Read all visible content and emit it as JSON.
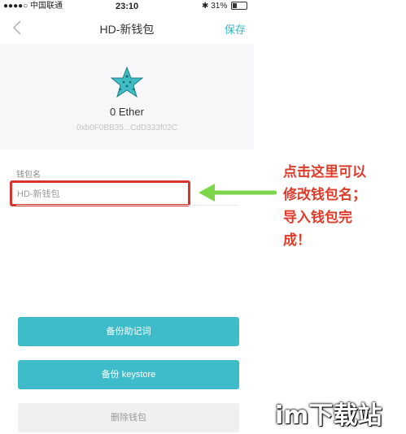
{
  "status_bar": {
    "carrier": "●●●●○ 中国联通",
    "time": "23:10",
    "battery": "31%"
  },
  "nav": {
    "title": "HD-新钱包",
    "save_label": "保存"
  },
  "wallet": {
    "balance": "0 Ether",
    "address": "0xb0F0BB35...CdD333f02C"
  },
  "form": {
    "label": "钱包名",
    "value": "HD-新钱包"
  },
  "buttons": {
    "backup_mnemonic": "备份助记词",
    "backup_keystore": "备份 keystore",
    "delete_wallet": "删除钱包"
  },
  "annotation": {
    "text": "点击这里可以\n修改钱包名；\n导入钱包完\n成！"
  },
  "watermark": {
    "text": "im下载站"
  },
  "colors": {
    "accent": "#3fbcca",
    "highlight": "#d9342b",
    "arrow": "#7cd64a"
  },
  "icons": {
    "back": "chevron-left-icon",
    "avatar": "starfish-icon",
    "arrow": "arrow-left-icon"
  }
}
